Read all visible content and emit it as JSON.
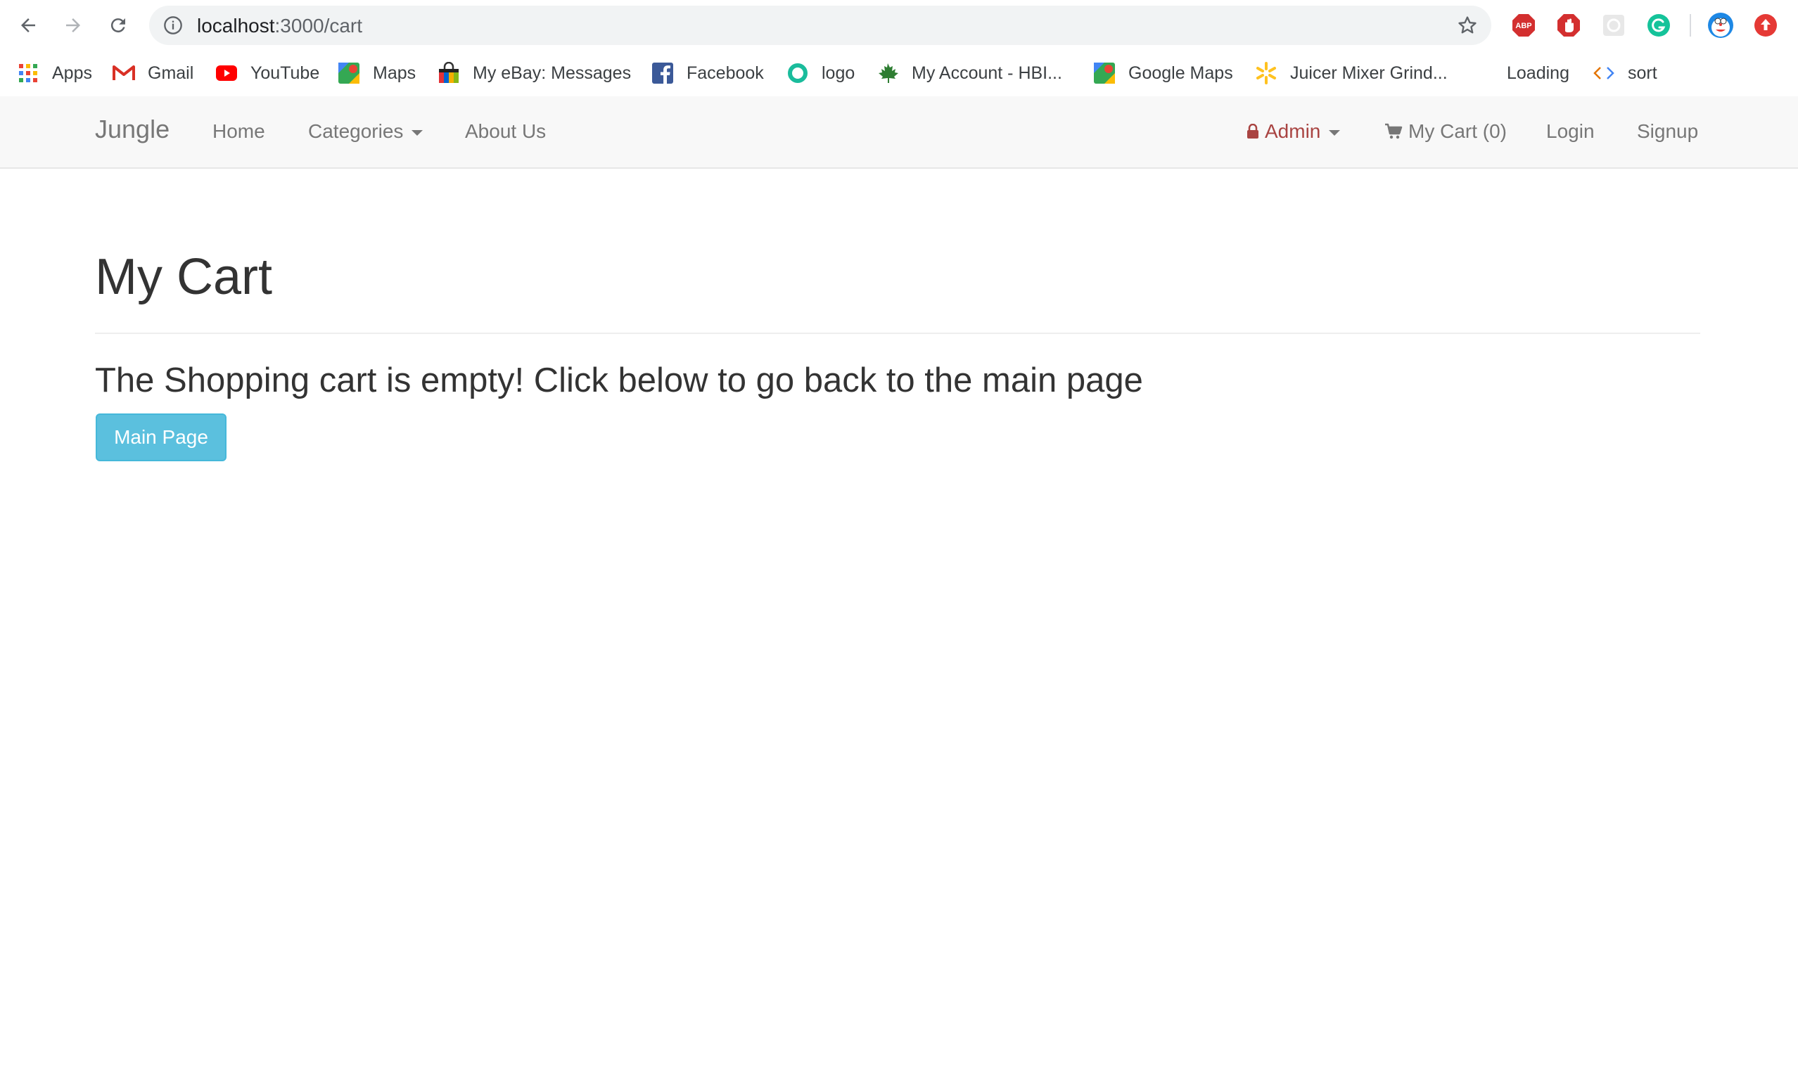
{
  "browser": {
    "url_host": "localhost",
    "url_path": ":3000/cart",
    "bookmarks": [
      {
        "label": "Apps",
        "icon": "apps-grid-icon"
      },
      {
        "label": "Gmail",
        "icon": "gmail-icon"
      },
      {
        "label": "YouTube",
        "icon": "youtube-icon"
      },
      {
        "label": "Maps",
        "icon": "maps-icon"
      },
      {
        "label": "My eBay: Messages",
        "icon": "ebay-bag-icon"
      },
      {
        "label": "Facebook",
        "icon": "facebook-icon"
      },
      {
        "label": "logo",
        "icon": "logo-ring-icon"
      },
      {
        "label": "My Account - HBI...",
        "icon": "maple-leaf-icon"
      },
      {
        "label": "Google Maps",
        "icon": "google-maps-icon"
      },
      {
        "label": "Juicer Mixer Grind...",
        "icon": "walmart-spark-icon"
      },
      {
        "label": "Loading",
        "icon": ""
      },
      {
        "label": "sort",
        "icon": "code-brackets-icon"
      }
    ],
    "extensions": [
      "adblock-plus-icon",
      "stop-hand-icon",
      "puzzle-extension-icon",
      "grammarly-icon",
      "doraemon-avatar-icon",
      "update-arrow-icon"
    ]
  },
  "navbar": {
    "brand": "Jungle",
    "home": "Home",
    "categories": "Categories",
    "about": "About Us",
    "admin": "Admin",
    "cart": "My Cart (0)",
    "login": "Login",
    "signup": "Signup"
  },
  "main": {
    "title": "My Cart",
    "empty_message": "The Shopping cart is empty! Click below to go back to the main page",
    "button_label": "Main Page"
  },
  "colors": {
    "navbar_bg": "#f8f8f8",
    "nav_text": "#777777",
    "admin_text": "#a94442",
    "button_bg": "#5bc0de"
  }
}
